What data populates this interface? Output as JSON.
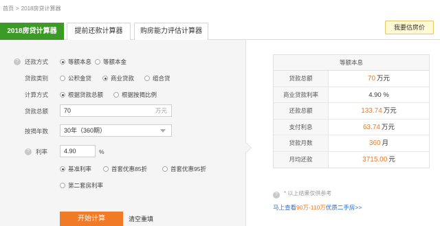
{
  "breadcrumb": {
    "home": "首页",
    "separator": ">",
    "current": "2018房贷计算器"
  },
  "tabs": [
    {
      "label": "2018房贷计算器",
      "active": true
    },
    {
      "label": "提前还款计算器",
      "active": false
    },
    {
      "label": "购房能力评估计算器",
      "active": false
    }
  ],
  "buy_button": "我要估房价",
  "form": {
    "repayment_method": {
      "label": "还款方式",
      "options": [
        "等额本息",
        "等额本金"
      ],
      "selected": 0
    },
    "loan_type": {
      "label": "贷款类别",
      "options": [
        "公积金贷",
        "商业贷款",
        "组合贷"
      ],
      "selected": 1
    },
    "calc_method": {
      "label": "计算方式",
      "options": [
        "根据贷款总额",
        "根据按揭比例"
      ],
      "selected": 0
    },
    "loan_amount": {
      "label": "贷款总额",
      "value": "70",
      "unit": "万元"
    },
    "years": {
      "label": "按揭年数",
      "value": "30年（360期）"
    },
    "rate": {
      "label": "利率",
      "value": "4.90",
      "unit": "%",
      "options": [
        "基准利率",
        "首套优惠85折",
        "首套优惠95折",
        "第二套房利率"
      ],
      "selected": 0
    },
    "start_button": "开始计算",
    "reset_link": "清空重填"
  },
  "result": {
    "header": "等额本息",
    "rows": [
      {
        "label": "贷款总额",
        "value": "70",
        "unit": "万元"
      },
      {
        "label": "商业贷款利率",
        "value": "4.90 %",
        "unit": ""
      },
      {
        "label": "还款总额",
        "value": "133.74",
        "unit": "万元"
      },
      {
        "label": "支付利息",
        "value": "63.74",
        "unit": "万元"
      },
      {
        "label": "贷款月数",
        "value": "360",
        "unit": "月"
      },
      {
        "label": "月均还款",
        "value": "3715.00",
        "unit": "元"
      }
    ],
    "note": "* 以上结果仅供参考",
    "more_link": {
      "prefix": "马上查看",
      "highlight": "90万-110万",
      "suffix": "优质二手房>>"
    }
  },
  "colors": {
    "accent_green": "#3c9a27",
    "accent_orange": "#f07a25",
    "link_blue": "#2a6fd6"
  }
}
